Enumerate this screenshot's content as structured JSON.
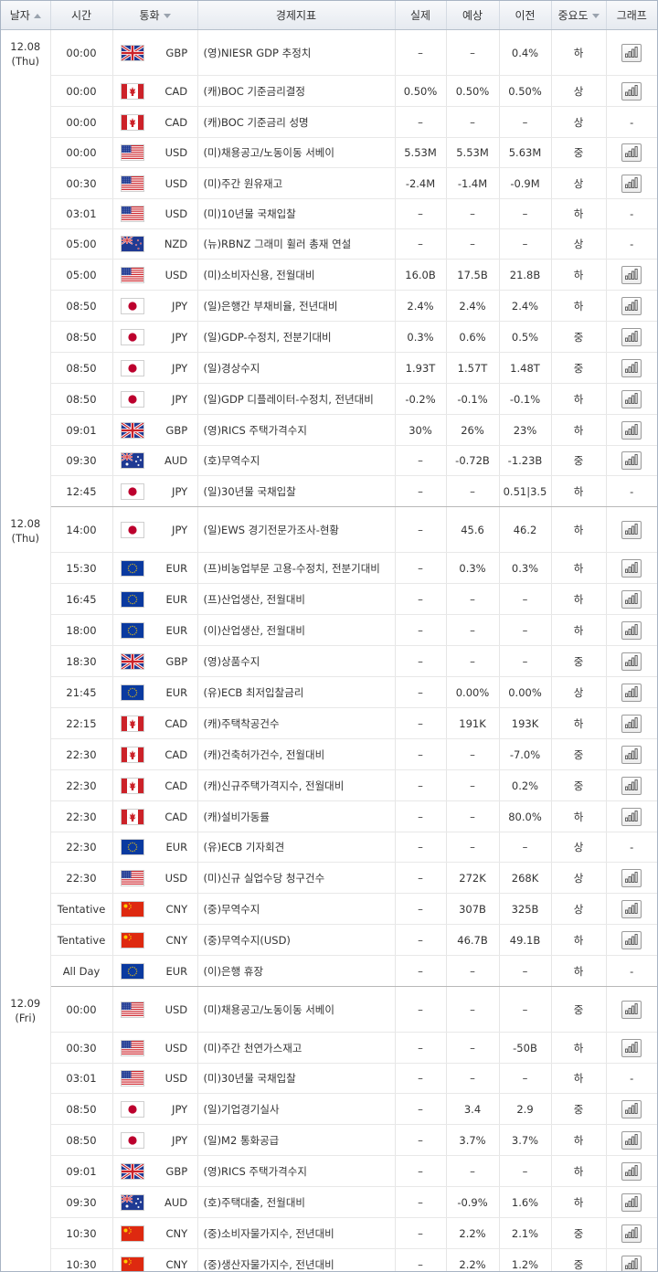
{
  "header": {
    "date": "날자",
    "time": "시간",
    "currency": "통화",
    "indicator": "경제지표",
    "actual": "실제",
    "forecast": "예상",
    "previous": "이전",
    "importance": "중요도",
    "graph": "그래프"
  },
  "flag_colors": {
    "red": "#cc2229",
    "blue": "#1f3a93",
    "white": "#ffffff",
    "eu_blue": "#0a3aa0",
    "eu_gold": "#ffcc00",
    "cn_red": "#de2910",
    "jp_red": "#bc002d"
  },
  "groups": [
    {
      "date": "12.08",
      "day": "(Thu)",
      "rows": [
        {
          "time": "00:00",
          "flag": "uk-flag",
          "cur": "GBP",
          "ind": "(영)NIESR GDP 추정치",
          "act": "–",
          "fc": "–",
          "prev": "0.4%",
          "imp": "하",
          "graph": true
        },
        {
          "time": "00:00",
          "flag": "ca-flag",
          "cur": "CAD",
          "ind": "(캐)BOC 기준금리결정",
          "act": "0.50%",
          "fc": "0.50%",
          "prev": "0.50%",
          "imp": "상",
          "graph": true
        },
        {
          "time": "00:00",
          "flag": "ca-flag",
          "cur": "CAD",
          "ind": "(캐)BOC 기준금리 성명",
          "act": "–",
          "fc": "–",
          "prev": "–",
          "imp": "상",
          "graph": false
        },
        {
          "time": "00:00",
          "flag": "us-flag",
          "cur": "USD",
          "ind": "(미)채용공고/노동이동 서베이",
          "act": "5.53M",
          "fc": "5.53M",
          "prev": "5.63M",
          "imp": "중",
          "graph": true
        },
        {
          "time": "00:30",
          "flag": "us-flag",
          "cur": "USD",
          "ind": "(미)주간 원유재고",
          "act": "-2.4M",
          "fc": "-1.4M",
          "prev": "-0.9M",
          "imp": "상",
          "graph": true
        },
        {
          "time": "03:01",
          "flag": "us-flag",
          "cur": "USD",
          "ind": "(미)10년물 국채입찰",
          "act": "–",
          "fc": "–",
          "prev": "–",
          "imp": "하",
          "graph": false
        },
        {
          "time": "05:00",
          "flag": "nz-flag",
          "cur": "NZD",
          "ind": "(뉴)RBNZ 그래미 휠러 총재 연설",
          "act": "–",
          "fc": "–",
          "prev": "–",
          "imp": "상",
          "graph": false
        },
        {
          "time": "05:00",
          "flag": "us-flag",
          "cur": "USD",
          "ind": "(미)소비자신용, 전월대비",
          "act": "16.0B",
          "fc": "17.5B",
          "prev": "21.8B",
          "imp": "하",
          "graph": true
        },
        {
          "time": "08:50",
          "flag": "jp-flag",
          "cur": "JPY",
          "ind": "(일)은행간 부채비율, 전년대비",
          "act": "2.4%",
          "fc": "2.4%",
          "prev": "2.4%",
          "imp": "하",
          "graph": true
        },
        {
          "time": "08:50",
          "flag": "jp-flag",
          "cur": "JPY",
          "ind": "(일)GDP-수정치, 전분기대비",
          "act": "0.3%",
          "fc": "0.6%",
          "prev": "0.5%",
          "imp": "중",
          "graph": true
        },
        {
          "time": "08:50",
          "flag": "jp-flag",
          "cur": "JPY",
          "ind": "(일)경상수지",
          "act": "1.93T",
          "fc": "1.57T",
          "prev": "1.48T",
          "imp": "중",
          "graph": true
        },
        {
          "time": "08:50",
          "flag": "jp-flag",
          "cur": "JPY",
          "ind": "(일)GDP 디플레이터-수정치, 전년대비",
          "act": "-0.2%",
          "fc": "-0.1%",
          "prev": "-0.1%",
          "imp": "하",
          "graph": true
        },
        {
          "time": "09:01",
          "flag": "uk-flag",
          "cur": "GBP",
          "ind": "(영)RICS 주택가격수지",
          "act": "30%",
          "fc": "26%",
          "prev": "23%",
          "imp": "하",
          "graph": true
        },
        {
          "time": "09:30",
          "flag": "au-flag",
          "cur": "AUD",
          "ind": "(호)무역수지",
          "act": "–",
          "fc": "-0.72B",
          "prev": "-1.23B",
          "imp": "중",
          "graph": true
        },
        {
          "time": "12:45",
          "flag": "jp-flag",
          "cur": "JPY",
          "ind": "(일)30년물 국채입찰",
          "act": "–",
          "fc": "–",
          "prev": "0.51|3.5",
          "imp": "하",
          "graph": false
        }
      ]
    },
    {
      "date": "12.08",
      "day": "(Thu)",
      "rows": [
        {
          "time": "14:00",
          "flag": "jp-flag",
          "cur": "JPY",
          "ind": "(일)EWS 경기전문가조사-현황",
          "act": "–",
          "fc": "45.6",
          "prev": "46.2",
          "imp": "하",
          "graph": true
        },
        {
          "time": "15:30",
          "flag": "eu-flag",
          "cur": "EUR",
          "ind": "(프)비농업부문 고용-수정치, 전분기대비",
          "act": "–",
          "fc": "0.3%",
          "prev": "0.3%",
          "imp": "하",
          "graph": true
        },
        {
          "time": "16:45",
          "flag": "eu-flag",
          "cur": "EUR",
          "ind": "(프)산업생산, 전월대비",
          "act": "–",
          "fc": "–",
          "prev": "–",
          "imp": "하",
          "graph": true
        },
        {
          "time": "18:00",
          "flag": "eu-flag",
          "cur": "EUR",
          "ind": "(이)산업생산, 전월대비",
          "act": "–",
          "fc": "–",
          "prev": "–",
          "imp": "하",
          "graph": true
        },
        {
          "time": "18:30",
          "flag": "uk-flag",
          "cur": "GBP",
          "ind": "(영)상품수지",
          "act": "–",
          "fc": "–",
          "prev": "–",
          "imp": "중",
          "graph": true
        },
        {
          "time": "21:45",
          "flag": "eu-flag",
          "cur": "EUR",
          "ind": "(유)ECB 최저입찰금리",
          "act": "–",
          "fc": "0.00%",
          "prev": "0.00%",
          "imp": "상",
          "graph": true
        },
        {
          "time": "22:15",
          "flag": "ca-flag",
          "cur": "CAD",
          "ind": "(캐)주택착공건수",
          "act": "–",
          "fc": "191K",
          "prev": "193K",
          "imp": "하",
          "graph": true
        },
        {
          "time": "22:30",
          "flag": "ca-flag",
          "cur": "CAD",
          "ind": "(캐)건축허가건수, 전월대비",
          "act": "–",
          "fc": "–",
          "prev": "-7.0%",
          "imp": "중",
          "graph": true
        },
        {
          "time": "22:30",
          "flag": "ca-flag",
          "cur": "CAD",
          "ind": "(캐)신규주택가격지수, 전월대비",
          "act": "–",
          "fc": "–",
          "prev": "0.2%",
          "imp": "중",
          "graph": true
        },
        {
          "time": "22:30",
          "flag": "ca-flag",
          "cur": "CAD",
          "ind": "(캐)설비가동률",
          "act": "–",
          "fc": "–",
          "prev": "80.0%",
          "imp": "하",
          "graph": true
        },
        {
          "time": "22:30",
          "flag": "eu-flag",
          "cur": "EUR",
          "ind": "(유)ECB 기자회견",
          "act": "–",
          "fc": "–",
          "prev": "–",
          "imp": "상",
          "graph": false
        },
        {
          "time": "22:30",
          "flag": "us-flag",
          "cur": "USD",
          "ind": "(미)신규 실업수당 청구건수",
          "act": "–",
          "fc": "272K",
          "prev": "268K",
          "imp": "상",
          "graph": true
        },
        {
          "time": "Tentative",
          "flag": "cn-flag",
          "cur": "CNY",
          "ind": "(중)무역수지",
          "act": "–",
          "fc": "307B",
          "prev": "325B",
          "imp": "상",
          "graph": true
        },
        {
          "time": "Tentative",
          "flag": "cn-flag",
          "cur": "CNY",
          "ind": "(중)무역수지(USD)",
          "act": "–",
          "fc": "46.7B",
          "prev": "49.1B",
          "imp": "하",
          "graph": true
        },
        {
          "time": "All Day",
          "flag": "eu-flag",
          "cur": "EUR",
          "ind": "(이)은행 휴장",
          "act": "–",
          "fc": "–",
          "prev": "–",
          "imp": "하",
          "graph": false
        }
      ]
    },
    {
      "date": "12.09",
      "day": "(Fri)",
      "rows": [
        {
          "time": "00:00",
          "flag": "us-flag",
          "cur": "USD",
          "ind": "(미)채용공고/노동이동 서베이",
          "act": "–",
          "fc": "–",
          "prev": "–",
          "imp": "중",
          "graph": true
        },
        {
          "time": "00:30",
          "flag": "us-flag",
          "cur": "USD",
          "ind": "(미)주간 천연가스재고",
          "act": "–",
          "fc": "–",
          "prev": "-50B",
          "imp": "하",
          "graph": true
        },
        {
          "time": "03:01",
          "flag": "us-flag",
          "cur": "USD",
          "ind": "(미)30년물 국채입찰",
          "act": "–",
          "fc": "–",
          "prev": "–",
          "imp": "하",
          "graph": false
        },
        {
          "time": "08:50",
          "flag": "jp-flag",
          "cur": "JPY",
          "ind": "(일)기업경기실사",
          "act": "–",
          "fc": "3.4",
          "prev": "2.9",
          "imp": "중",
          "graph": true
        },
        {
          "time": "08:50",
          "flag": "jp-flag",
          "cur": "JPY",
          "ind": "(일)M2 통화공급",
          "act": "–",
          "fc": "3.7%",
          "prev": "3.7%",
          "imp": "하",
          "graph": true
        },
        {
          "time": "09:01",
          "flag": "uk-flag",
          "cur": "GBP",
          "ind": "(영)RICS 주택가격수지",
          "act": "–",
          "fc": "–",
          "prev": "–",
          "imp": "하",
          "graph": true
        },
        {
          "time": "09:30",
          "flag": "au-flag",
          "cur": "AUD",
          "ind": "(호)주택대출, 전월대비",
          "act": "–",
          "fc": "-0.9%",
          "prev": "1.6%",
          "imp": "하",
          "graph": true
        },
        {
          "time": "10:30",
          "flag": "cn-flag",
          "cur": "CNY",
          "ind": "(중)소비자물가지수, 전년대비",
          "act": "–",
          "fc": "2.2%",
          "prev": "2.1%",
          "imp": "중",
          "graph": true
        },
        {
          "time": "10:30",
          "flag": "cn-flag",
          "cur": "CNY",
          "ind": "(중)생산자물가지수, 전년대비",
          "act": "–",
          "fc": "2.2%",
          "prev": "1.2%",
          "imp": "중",
          "graph": true
        }
      ]
    }
  ]
}
